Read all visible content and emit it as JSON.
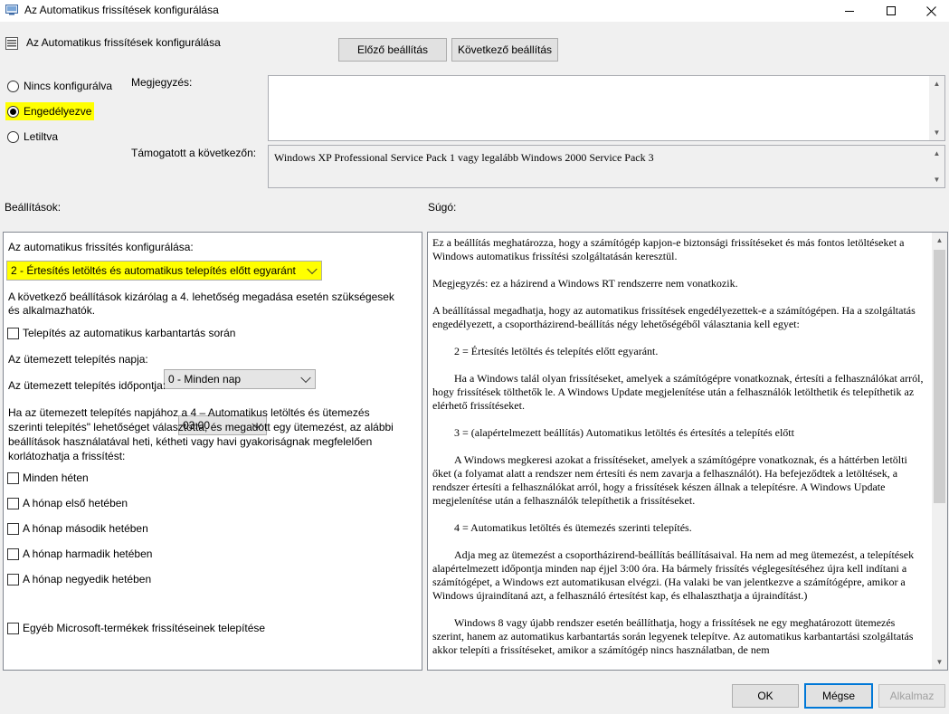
{
  "window": {
    "title": "Az Automatikus frissítések konfigurálása",
    "controls": {
      "minimize": "—",
      "maximize": "☐",
      "close": "✕"
    }
  },
  "header": {
    "title": "Az Automatikus frissítések konfigurálása",
    "prev_button": "Előző beállítás",
    "next_button": "Következő beállítás"
  },
  "state": {
    "options": [
      {
        "label": "Nincs konfigurálva",
        "selected": false
      },
      {
        "label": "Engedélyezve",
        "selected": true
      },
      {
        "label": "Letiltva",
        "selected": false
      }
    ]
  },
  "comment": {
    "label": "Megjegyzés:",
    "value": ""
  },
  "supported": {
    "label": "Támogatott a következőn:",
    "value": "Windows XP Professional Service Pack 1 vagy legalább Windows 2000 Service Pack 3"
  },
  "sections": {
    "options_label": "Beállítások:",
    "help_label": "Súgó:"
  },
  "options_panel": {
    "config_label": "Az automatikus frissítés konfigurálása:",
    "config_value": "2 - Értesítés letöltés és automatikus telepítés előtt egyaránt",
    "note": "A következő beállítások kizárólag a 4. lehetőség megadása esetén szükségesek és alkalmazhatók.",
    "maintenance_checkbox": "Telepítés az automatikus karbantartás során",
    "day_label": "Az ütemezett telepítés napja:",
    "day_value": "0 - Minden nap",
    "time_label": "Az ütemezett telepítés időpontja:",
    "time_value": "03:00",
    "schedule_note": "Ha az ütemezett telepítés napjához a 4 – Automatikus letöltés és ütemezés szerinti telepítés\" lehetőséget választotta, és megadott egy ütemezést, az alábbi beállítások használatával heti, kétheti vagy havi gyakoriságnak megfelelően korlátozhatja a frissítést:",
    "week_checkboxes": [
      "Minden héten",
      "A hónap első hetében",
      "A hónap második hetében",
      "A hónap harmadik hetében",
      "A hónap negyedik hetében"
    ],
    "other_products_checkbox": "Egyéb Microsoft-termékek frissítéseinek telepítése"
  },
  "help": {
    "paragraphs": [
      "Ez a beállítás meghatározza, hogy a számítógép kapjon-e biztonsági frissítéseket és más fontos letöltéseket a Windows automatikus frissítési szolgáltatásán keresztül.",
      "Megjegyzés: ez a házirend a Windows RT rendszerre nem vonatkozik.",
      "A beállítással megadhatja, hogy az automatikus frissítések engedélyezettek-e a számítógépen. Ha a szolgáltatás engedélyezett, a csoportházirend-beállítás négy lehetőségéből választania kell egyet:",
      "        2 = Értesítés letöltés és telepítés előtt egyaránt.",
      "        Ha a Windows talál olyan frissítéseket, amelyek a számítógépre vonatkoznak, értesíti a felhasználókat arról, hogy frissítések tölthetők le. A Windows Update megjelenítése után a felhasználók letölthetik és telepíthetik az elérhető frissítéseket.",
      "        3 = (alapértelmezett beállítás) Automatikus letöltés és értesítés a telepítés előtt",
      "        A Windows megkeresi azokat a frissítéseket, amelyek a számítógépre vonatkoznak, és a háttérben letölti őket (a folyamat alatt a rendszer nem értesíti és nem zavarja a felhasználót). Ha befejeződtek a letöltések, a rendszer értesíti a felhasználókat arról, hogy a frissítések készen állnak a telepítésre. A Windows Update megjelenítése után a felhasználók telepíthetik a frissítéseket.",
      "        4 = Automatikus letöltés és ütemezés szerinti telepítés.",
      "        Adja meg az ütemezést a csoportházirend-beállítás beállításaival. Ha nem ad meg ütemezést, a telepítések alapértelmezett időpontja minden nap éjjel 3:00 óra. Ha bármely frissítés véglegesítéséhez újra kell indítani a számítógépet, a Windows ezt automatikusan elvégzi. (Ha valaki be van jelentkezve a számítógépre, amikor a Windows újraindítaná azt, a felhasználó értesítést kap, és elhalaszthatja a újraindítást.)",
      "        Windows 8 vagy újabb rendszer esetén beállíthatja, hogy a frissítések ne egy meghatározott ütemezés szerint, hanem az automatikus karbantartás során legyenek telepítve. Az automatikus karbantartási szolgáltatás akkor telepíti a frissítéseket, amikor a számítógép nincs használatban, de nem"
    ]
  },
  "footer": {
    "ok": "OK",
    "cancel": "Mégse",
    "apply": "Alkalmaz"
  },
  "colors": {
    "highlight": "#ffff00",
    "accent": "#0078d7"
  }
}
